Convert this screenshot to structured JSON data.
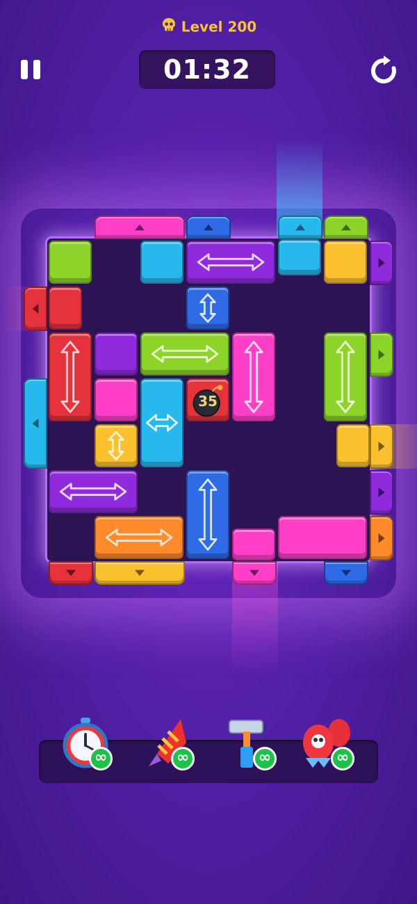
{
  "header": {
    "level_label": "Level 200",
    "timer": "01:32"
  },
  "icons": {
    "level": "skull-icon",
    "pause": "pause-icon",
    "restart": "restart-icon",
    "bomb": "bomb-icon"
  },
  "board": {
    "bomb_count": "35"
  },
  "powerups": [
    {
      "name": "stopwatch",
      "icon": "stopwatch-icon",
      "count": "∞"
    },
    {
      "name": "firework-rocket",
      "icon": "rocket-icon",
      "count": "∞"
    },
    {
      "name": "hammer",
      "icon": "hammer-icon",
      "count": "∞"
    },
    {
      "name": "skull-rockets",
      "icon": "skull-rockets-icon",
      "count": "∞"
    }
  ],
  "colors": {
    "red": "#e6323c",
    "purple": "#8f2bdc",
    "cyan": "#27b8ee",
    "green": "#8dd42a",
    "yellow": "#fbc02d",
    "pink": "#ff3fc8",
    "blue": "#2f6be6",
    "orange": "#ff8a2c",
    "level_gold": "#f6c531",
    "infinity_green": "#1ec24b"
  }
}
